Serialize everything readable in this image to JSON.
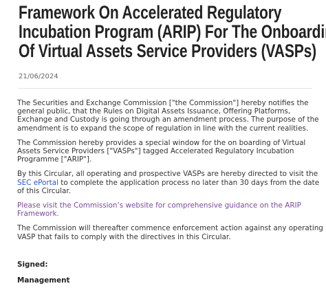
{
  "article": {
    "title_lines": [
      "Framework On Accelerated Regulatory",
      "Incubation Program (ARIP) For The Onboarding",
      "Of Virtual Assets Service Providers (VASPs)"
    ],
    "date": "21/06/2024",
    "paragraphs": {
      "p1": "The Securities and Exchange Commission [\"the Commission\"] hereby notifies the general public, that the Rules on Digital Assets Issuance, Offering Platforms, Exchange and Custody is going through an amendment process. The purpose of the amendment is to expand the scope of regulation in line with the current realities.",
      "p2": "The Commission hereby provides a special window for the on boarding of Virtual Assets Service Providers [\"VASPs\"] tagged Accelerated Regulatory Incubation Programme [\"ARIP\"].",
      "p3_before": "By this Circular, all operating and prospective VASPs are hereby directed to visit the ",
      "p3_link": "SEC ePortal",
      "p3_after": " to complete the application process no later than 30 days from the date of this Circular.",
      "p4": "Please visit the Commission’s website for comprehensive guidance on the ARIP Framework.",
      "p5": "The Commission will thereafter commence enforcement action against any operating VASP that fails to comply with the directives in this Circular."
    },
    "signed": "Signed:",
    "signatory": "Management"
  },
  "colors": {
    "link": "#2a56c6",
    "visited_link": "#7a4a9a"
  }
}
